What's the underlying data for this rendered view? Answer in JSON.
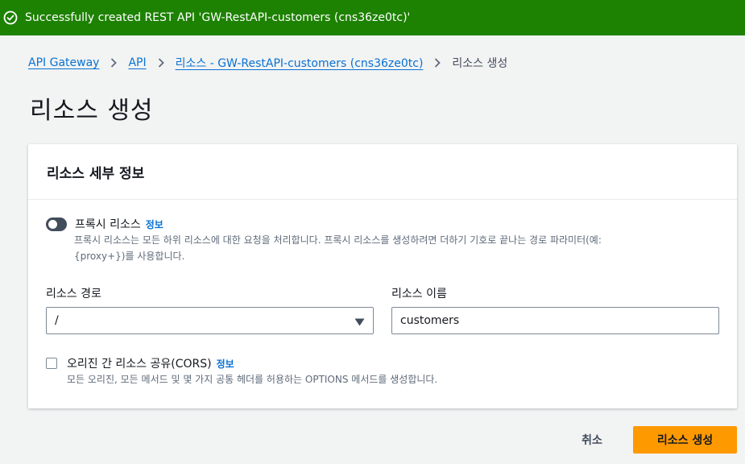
{
  "flash": {
    "message": "Successfully created REST API 'GW-RestAPI-customers (cns36ze0tc)'",
    "icon": "check-circle-icon",
    "color": "#1d8102"
  },
  "breadcrumb": {
    "items": [
      "API Gateway",
      "API",
      "리소스 - GW-RestAPI-customers (cns36ze0tc)"
    ],
    "current": "리소스 생성"
  },
  "page": {
    "title": "리소스 생성"
  },
  "panel": {
    "title": "리소스 세부 정보",
    "proxy": {
      "label": "프록시 리소스",
      "info": "정보",
      "description_line1": "프록시 리소스는 모든 하위 리소스에 대한 요청을 처리합니다. 프록시 리소스를 생성하려면 더하기 기호로 끝나는 경로 파라미터(예:",
      "description_line2": "{proxy+})를 사용합니다.",
      "enabled": false
    },
    "resource_path": {
      "label": "리소스 경로",
      "value": "/"
    },
    "resource_name": {
      "label": "리소스 이름",
      "value": "customers"
    },
    "cors": {
      "label": "오리진 간 리소스 공유(CORS)",
      "info": "정보",
      "description": "모든 오리진, 모든 메서드 및 몇 가지 공통 헤더를 허용하는 OPTIONS 메서드를 생성합니다.",
      "checked": false
    }
  },
  "actions": {
    "cancel": "취소",
    "create": "리소스 생성",
    "primary_color": "#ff9900"
  }
}
